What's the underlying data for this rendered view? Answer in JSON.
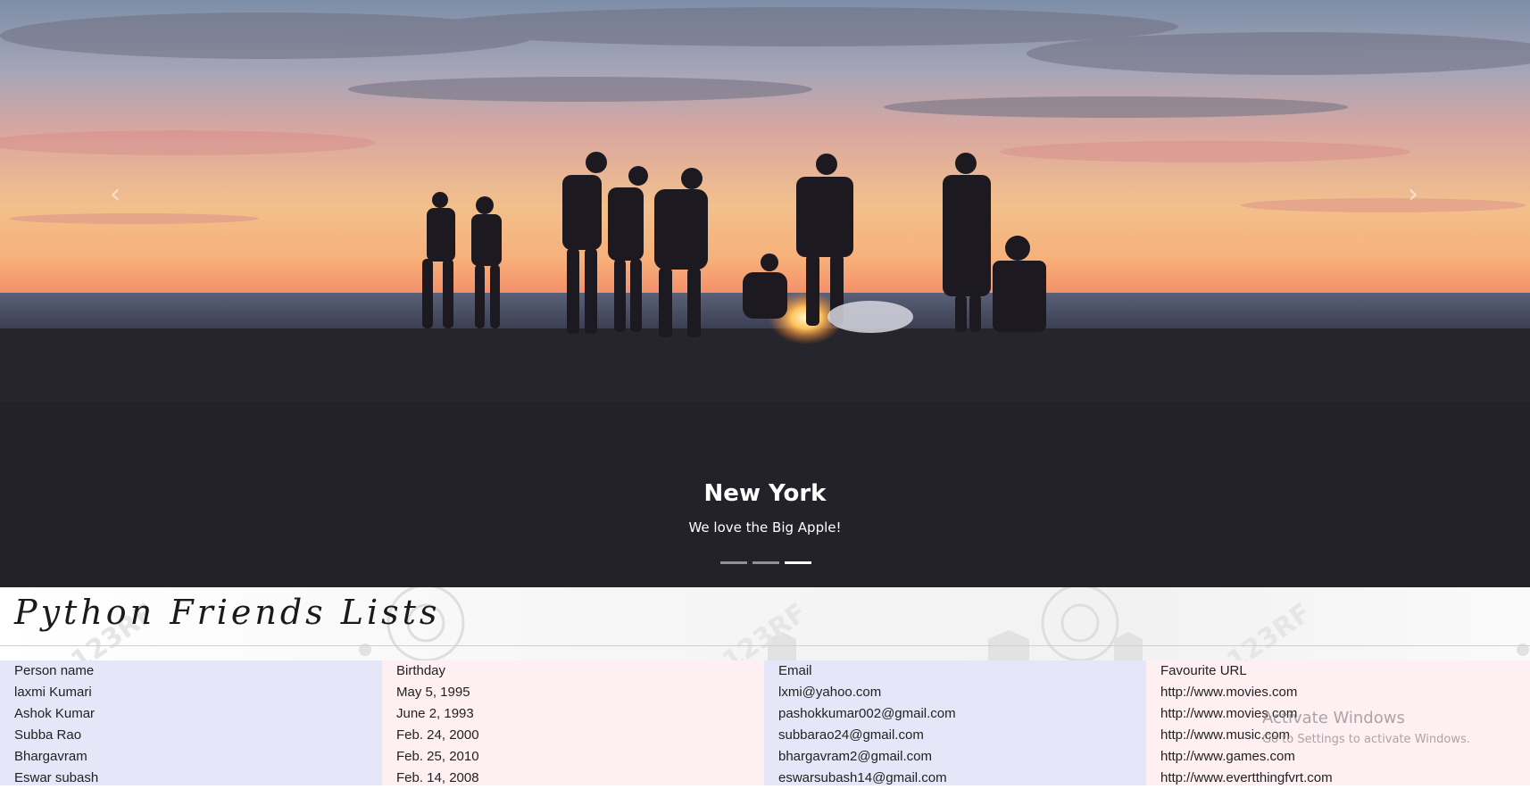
{
  "carousel": {
    "prev_icon": "chevron-left-icon",
    "next_icon": "chevron-right-icon",
    "caption_title": "New York",
    "caption_text": "We love the Big Apple!",
    "indicator_count": 3,
    "active_indicator": 3
  },
  "page_title": "Python Friends Lists",
  "table": {
    "columns": [
      {
        "header": "Person name",
        "cells": [
          "laxmi Kumari",
          "Ashok Kumar",
          "Subba Rao",
          "Bhargavram",
          "Eswar subash"
        ]
      },
      {
        "header": "Birthday",
        "cells": [
          "May 5, 1995",
          "June 2, 1993",
          "Feb. 24, 2000",
          "Feb. 25, 2010",
          "Feb. 14, 2008"
        ]
      },
      {
        "header": "Email",
        "cells": [
          "lxmi@yahoo.com",
          "pashokkumar002@gmail.com",
          "subbarao24@gmail.com",
          "bhargavram2@gmail.com",
          "eswarsubash14@gmail.com"
        ]
      },
      {
        "header": "Favourite URL",
        "cells": [
          "http://www.movies.com",
          "http://www.movies.com",
          "http://www.music.com",
          "http://www.games.com",
          "http://www.evertthingfvrt.com"
        ]
      }
    ]
  },
  "os_overlay": {
    "title": "Activate Windows",
    "subtitle": "Go to Settings to activate Windows."
  },
  "colors": {
    "column_lavender": "#e6e6f9",
    "column_pink": "#fdeff2"
  }
}
